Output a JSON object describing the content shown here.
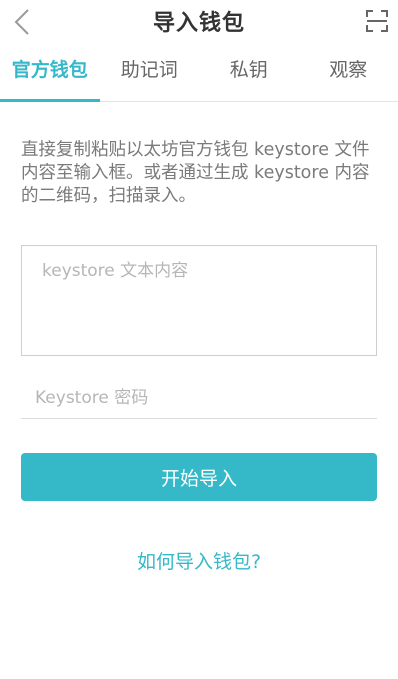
{
  "header": {
    "title": "导入钱包",
    "back_icon": "chevron-left-icon",
    "scan_icon": "scan-frame-icon"
  },
  "tabs": [
    {
      "label": "官方钱包",
      "active": true
    },
    {
      "label": "助记词",
      "active": false
    },
    {
      "label": "私钥",
      "active": false
    },
    {
      "label": "观察",
      "active": false
    }
  ],
  "description": "直接复制粘贴以太坊官方钱包 keystore 文件内容至输入框。或者通过生成 keystore 内容的二维码，扫描录入。",
  "keystore_input": {
    "value": "",
    "placeholder": "keystore 文本内容"
  },
  "password_input": {
    "value": "",
    "placeholder": "Keystore 密码"
  },
  "import_button": {
    "label": "开始导入"
  },
  "help_link": {
    "label": "如何导入钱包?"
  },
  "colors": {
    "accent": "#35b8c8",
    "title_text": "#333333",
    "body_text": "#7a7a7a",
    "placeholder": "#b6b6b6"
  }
}
